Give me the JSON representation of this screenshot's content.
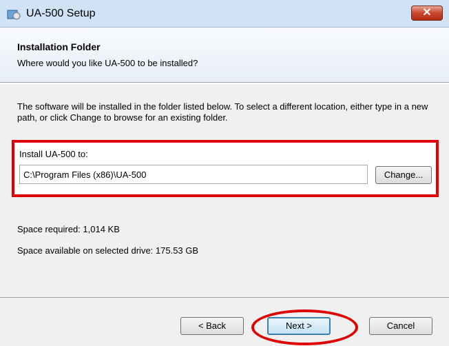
{
  "window": {
    "title": "UA-500 Setup",
    "close_label": "✕"
  },
  "banner": {
    "title": "Installation Folder",
    "subtitle": "Where would you like UA-500 to be installed?"
  },
  "content": {
    "description": "The software will be installed in the folder listed below. To select a different location, either type in a new path, or click Change to browse for an existing folder.",
    "install_label": "Install UA-500 to:",
    "install_path": "C:\\Program Files (x86)\\UA-500",
    "change_label": "Change...",
    "space_required": "Space required: 1,014 KB",
    "space_available": "Space available on selected drive: 175.53 GB"
  },
  "buttons": {
    "back": "< Back",
    "next": "Next >",
    "cancel": "Cancel"
  },
  "colors": {
    "highlight": "#e00000",
    "titlebar": "#cfe2f6"
  }
}
